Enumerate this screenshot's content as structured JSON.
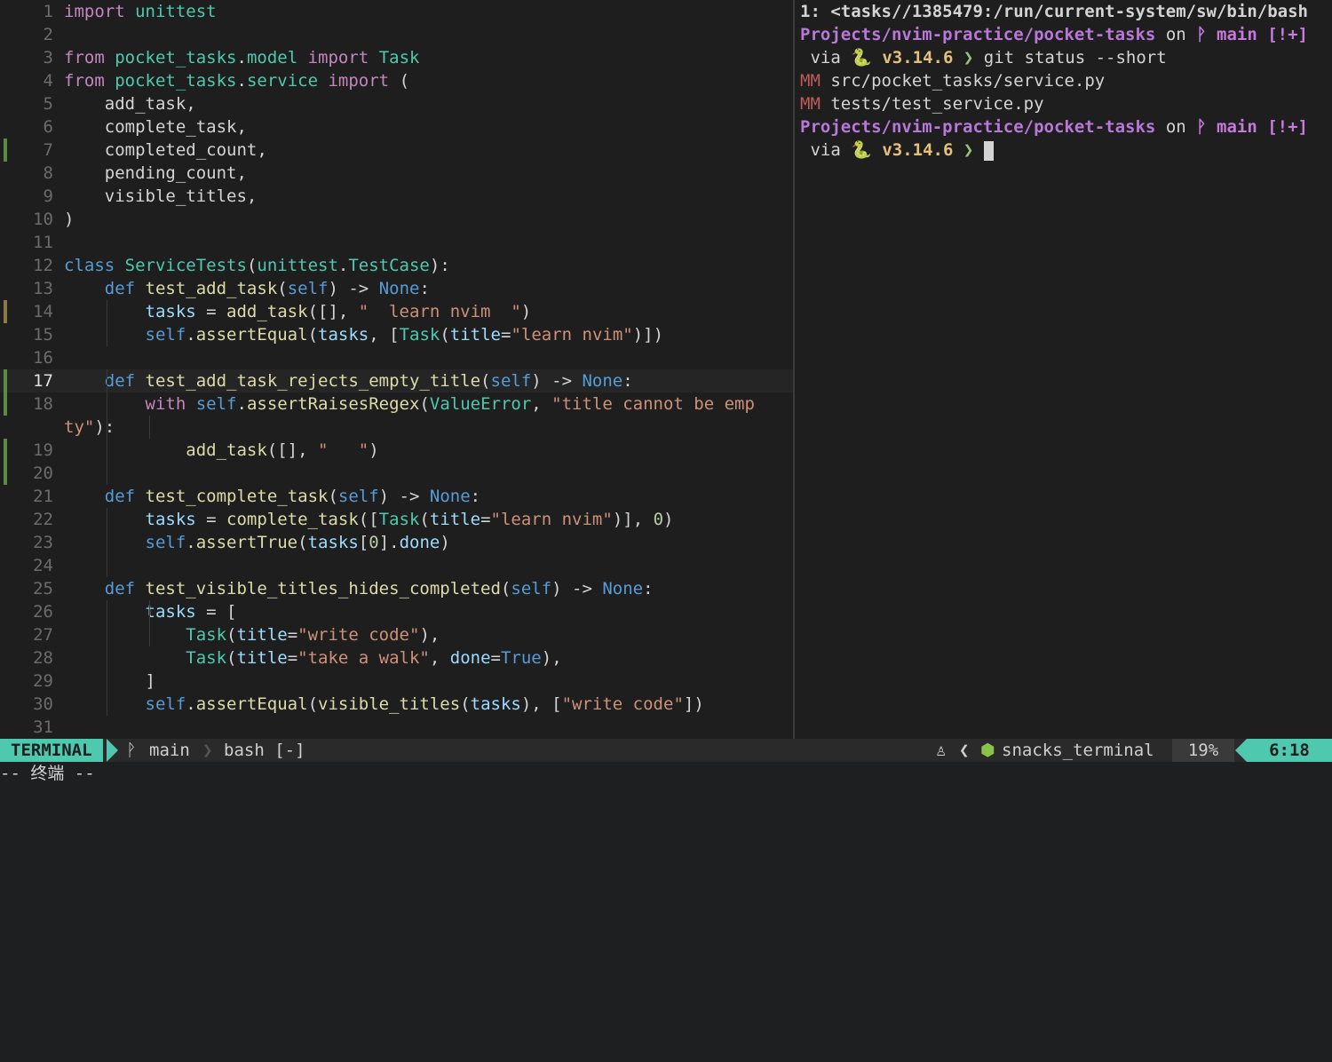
{
  "editor": {
    "lines": [
      {
        "n": "1",
        "sign": "",
        "html": [
          [
            "kw",
            "import"
          ],
          [
            "",
            " "
          ],
          [
            "mod",
            "unittest"
          ]
        ]
      },
      {
        "n": "2",
        "sign": "",
        "html": []
      },
      {
        "n": "3",
        "sign": "",
        "html": [
          [
            "kw",
            "from"
          ],
          [
            "",
            " "
          ],
          [
            "mod",
            "pocket_tasks"
          ],
          [
            "",
            "."
          ],
          [
            "mod",
            "model"
          ],
          [
            "",
            " "
          ],
          [
            "kw",
            "import"
          ],
          [
            "",
            " "
          ],
          [
            "cls",
            "Task"
          ]
        ]
      },
      {
        "n": "4",
        "sign": "",
        "html": [
          [
            "kw",
            "from"
          ],
          [
            "",
            " "
          ],
          [
            "mod",
            "pocket_tasks"
          ],
          [
            "",
            "."
          ],
          [
            "mod",
            "service"
          ],
          [
            "",
            " "
          ],
          [
            "kw",
            "import"
          ],
          [
            "",
            " ("
          ]
        ]
      },
      {
        "n": "5",
        "sign": "",
        "html": [
          [
            "",
            "    add_task,"
          ]
        ]
      },
      {
        "n": "6",
        "sign": "",
        "html": [
          [
            "",
            "    complete_task,"
          ]
        ]
      },
      {
        "n": "7",
        "sign": "add",
        "html": [
          [
            "",
            "    completed_count,"
          ]
        ]
      },
      {
        "n": "8",
        "sign": "",
        "html": [
          [
            "",
            "    pending_count,"
          ]
        ]
      },
      {
        "n": "9",
        "sign": "",
        "html": [
          [
            "",
            "    visible_titles,"
          ]
        ]
      },
      {
        "n": "10",
        "sign": "",
        "html": [
          [
            "",
            ")"
          ]
        ]
      },
      {
        "n": "11",
        "sign": "",
        "html": []
      },
      {
        "n": "12",
        "sign": "",
        "html": [
          [
            "kw2",
            "class"
          ],
          [
            "",
            " "
          ],
          [
            "cls",
            "ServiceTests"
          ],
          [
            "",
            "("
          ],
          [
            "mod",
            "unittest"
          ],
          [
            "",
            "."
          ],
          [
            "cls",
            "TestCase"
          ],
          [
            "",
            "):"
          ]
        ]
      },
      {
        "n": "13",
        "sign": "",
        "html": [
          [
            "",
            "    "
          ],
          [
            "kw2",
            "def"
          ],
          [
            "",
            " "
          ],
          [
            "fn",
            "test_add_task"
          ],
          [
            "",
            "("
          ],
          [
            "self",
            "self"
          ],
          [
            "",
            ") -> "
          ],
          [
            "const",
            "None"
          ],
          [
            "",
            ":"
          ]
        ]
      },
      {
        "n": "14",
        "sign": "chg",
        "html": [
          [
            "",
            "        "
          ],
          [
            "var",
            "tasks"
          ],
          [
            "",
            " = "
          ],
          [
            "fn",
            "add_task"
          ],
          [
            "",
            "([], "
          ],
          [
            "str",
            "\"  learn nvim  \""
          ],
          [
            "",
            ")"
          ]
        ]
      },
      {
        "n": "15",
        "sign": "",
        "html": [
          [
            "",
            "        "
          ],
          [
            "self",
            "self"
          ],
          [
            "",
            "."
          ],
          [
            "fn",
            "assertEqual"
          ],
          [
            "",
            "("
          ],
          [
            "var",
            "tasks"
          ],
          [
            "",
            ", ["
          ],
          [
            "cls",
            "Task"
          ],
          [
            "",
            "("
          ],
          [
            "param",
            "title"
          ],
          [
            "",
            "="
          ],
          [
            "str",
            "\"learn nvim\""
          ],
          [
            "",
            ")])"
          ]
        ]
      },
      {
        "n": "16",
        "sign": "",
        "html": []
      },
      {
        "n": "17",
        "sign": "add",
        "cur": true,
        "html": [
          [
            "",
            "    "
          ],
          [
            "kw2",
            "def"
          ],
          [
            "",
            " "
          ],
          [
            "fn",
            "test_add_task_rejects_empty_title"
          ],
          [
            "",
            "("
          ],
          [
            "self",
            "self"
          ],
          [
            "",
            ") -> "
          ],
          [
            "const",
            "None"
          ],
          [
            "",
            ":"
          ]
        ]
      },
      {
        "n": "18",
        "sign": "add",
        "html": [
          [
            "",
            "        "
          ],
          [
            "kw",
            "with"
          ],
          [
            "",
            " "
          ],
          [
            "self",
            "self"
          ],
          [
            "",
            "."
          ],
          [
            "fn",
            "assertRaisesRegex"
          ],
          [
            "",
            "("
          ],
          [
            "cls",
            "ValueError"
          ],
          [
            "",
            ", "
          ],
          [
            "str",
            "\"title cannot be emp"
          ]
        ]
      },
      {
        "n": "",
        "sign": "",
        "html": [
          [
            "str",
            "ty\""
          ],
          [
            "",
            "):"
          ]
        ]
      },
      {
        "n": "19",
        "sign": "add",
        "html": [
          [
            "",
            "            "
          ],
          [
            "fn",
            "add_task"
          ],
          [
            "",
            "([], "
          ],
          [
            "str",
            "\"   \""
          ],
          [
            "",
            ")"
          ]
        ]
      },
      {
        "n": "20",
        "sign": "add",
        "html": []
      },
      {
        "n": "21",
        "sign": "",
        "html": [
          [
            "",
            "    "
          ],
          [
            "kw2",
            "def"
          ],
          [
            "",
            " "
          ],
          [
            "fn",
            "test_complete_task"
          ],
          [
            "",
            "("
          ],
          [
            "self",
            "self"
          ],
          [
            "",
            ") -> "
          ],
          [
            "const",
            "None"
          ],
          [
            "",
            ":"
          ]
        ]
      },
      {
        "n": "22",
        "sign": "",
        "html": [
          [
            "",
            "        "
          ],
          [
            "var",
            "tasks"
          ],
          [
            "",
            " = "
          ],
          [
            "fn",
            "complete_task"
          ],
          [
            "",
            "(["
          ],
          [
            "cls",
            "Task"
          ],
          [
            "",
            "("
          ],
          [
            "param",
            "title"
          ],
          [
            "",
            "="
          ],
          [
            "str",
            "\"learn nvim\""
          ],
          [
            "",
            ")], "
          ],
          [
            "num",
            "0"
          ],
          [
            "",
            ")"
          ]
        ]
      },
      {
        "n": "23",
        "sign": "",
        "html": [
          [
            "",
            "        "
          ],
          [
            "self",
            "self"
          ],
          [
            "",
            "."
          ],
          [
            "fn",
            "assertTrue"
          ],
          [
            "",
            "("
          ],
          [
            "var",
            "tasks"
          ],
          [
            "",
            "["
          ],
          [
            "num",
            "0"
          ],
          [
            "",
            "]."
          ],
          [
            "var",
            "done"
          ],
          [
            "",
            ")"
          ]
        ]
      },
      {
        "n": "24",
        "sign": "",
        "html": []
      },
      {
        "n": "25",
        "sign": "",
        "html": [
          [
            "",
            "    "
          ],
          [
            "kw2",
            "def"
          ],
          [
            "",
            " "
          ],
          [
            "fn",
            "test_visible_titles_hides_completed"
          ],
          [
            "",
            "("
          ],
          [
            "self",
            "self"
          ],
          [
            "",
            ") -> "
          ],
          [
            "const",
            "None"
          ],
          [
            "",
            ":"
          ]
        ]
      },
      {
        "n": "26",
        "sign": "",
        "html": [
          [
            "",
            "        "
          ],
          [
            "var",
            "tasks"
          ],
          [
            "",
            " = ["
          ]
        ]
      },
      {
        "n": "27",
        "sign": "",
        "html": [
          [
            "",
            "            "
          ],
          [
            "cls",
            "Task"
          ],
          [
            "",
            "("
          ],
          [
            "param",
            "title"
          ],
          [
            "",
            "="
          ],
          [
            "str",
            "\"write code\""
          ],
          [
            "",
            "),"
          ]
        ]
      },
      {
        "n": "28",
        "sign": "",
        "html": [
          [
            "",
            "            "
          ],
          [
            "cls",
            "Task"
          ],
          [
            "",
            "("
          ],
          [
            "param",
            "title"
          ],
          [
            "",
            "="
          ],
          [
            "str",
            "\"take a walk\""
          ],
          [
            "",
            ", "
          ],
          [
            "param",
            "done"
          ],
          [
            "",
            "="
          ],
          [
            "const",
            "True"
          ],
          [
            "",
            "),"
          ]
        ]
      },
      {
        "n": "29",
        "sign": "",
        "html": [
          [
            "",
            "        ]"
          ]
        ]
      },
      {
        "n": "30",
        "sign": "",
        "html": [
          [
            "",
            "        "
          ],
          [
            "self",
            "self"
          ],
          [
            "",
            "."
          ],
          [
            "fn",
            "assertEqual"
          ],
          [
            "",
            "("
          ],
          [
            "fn",
            "visible_titles"
          ],
          [
            "",
            "("
          ],
          [
            "var",
            "tasks"
          ],
          [
            "",
            "), ["
          ],
          [
            "str",
            "\"write code\""
          ],
          [
            "",
            "])"
          ]
        ]
      },
      {
        "n": "31",
        "sign": "",
        "html": []
      }
    ]
  },
  "terminal": {
    "title": "1: <tasks//1385479:/run/current-system/sw/bin/bash",
    "prompt_path": "Projects/nvim-practice/pocket-tasks",
    "on": " on ",
    "branch_icon": "git-branch-icon",
    "branch": "main",
    "branch_status": "[!+]",
    "via": " via ",
    "python_icon": "🐍",
    "python_version": "v3.14.6",
    "prompt_char": "❯",
    "command": "git status --short",
    "status_lines": [
      {
        "flag": "MM",
        "file": "src/pocket_tasks/service.py"
      },
      {
        "flag": "MM",
        "file": "tests/test_service.py"
      }
    ]
  },
  "statusline": {
    "mode": "TERMINAL",
    "branch": "main",
    "buffer": "bash [-]",
    "filetype": "snacks_terminal",
    "percent": "19%",
    "position": "6:18"
  },
  "cmdline": "-- 终端 --",
  "colors": {
    "accent": "#4ec9b0",
    "path": "#b977d9",
    "python": "#e5c07b"
  }
}
